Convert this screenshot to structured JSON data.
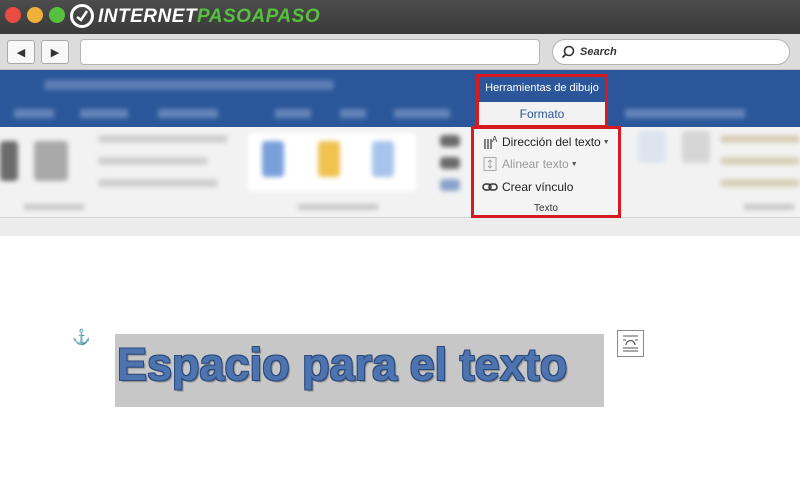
{
  "browser": {
    "logo_part1": "INTERNET",
    "logo_part2": "PASOAPASO",
    "back_symbol": "◀",
    "forward_symbol": "▶",
    "search_label": "Search",
    "icons": {
      "back": "back-arrow-icon",
      "forward": "forward-arrow-icon",
      "search": "search-icon"
    }
  },
  "word": {
    "drawing_tools": {
      "title": "Herramientas de dibujo",
      "tab": "Formato"
    },
    "text_group": {
      "items": [
        {
          "label": "Dirección del texto",
          "icon": "text-direction-icon",
          "enabled": true
        },
        {
          "label": "Alinear texto",
          "icon": "align-text-icon",
          "enabled": false
        },
        {
          "label": "Crear vínculo",
          "icon": "link-icon",
          "enabled": true
        }
      ],
      "group_label": "Texto"
    }
  },
  "document": {
    "textbox_text": "Espacio para el texto",
    "icons": {
      "anchor": "anchor-icon",
      "layout": "layout-options-icon"
    }
  },
  "colors": {
    "ribbon_blue": "#2b579a",
    "highlight_red": "#d71920",
    "wordart_blue": "#4e74b0"
  }
}
